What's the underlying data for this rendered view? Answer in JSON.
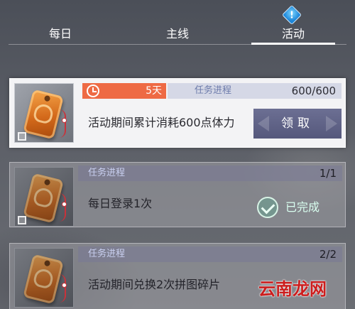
{
  "tabs": [
    {
      "label": "每日"
    },
    {
      "label": "主线"
    },
    {
      "label": "活动"
    }
  ],
  "alert_badge": "!",
  "tasks": [
    {
      "countdown": "5天",
      "progress_label": "任务进程",
      "progress_value": "600/600",
      "description": "活动期间累计消耗600点体力",
      "action_label": "领取"
    },
    {
      "progress_label": "任务进程",
      "progress_value": "1/1",
      "description": "每日登录1次",
      "status_label": "已完成"
    },
    {
      "progress_label": "任务进程",
      "progress_value": "2/2",
      "description": "活动期间兑换2次拼图碎片"
    }
  ],
  "watermark": "云南龙网",
  "colors": {
    "accent_orange": "#ee6a44",
    "claim_button": "#5f6286",
    "done_green": "#46c896"
  }
}
